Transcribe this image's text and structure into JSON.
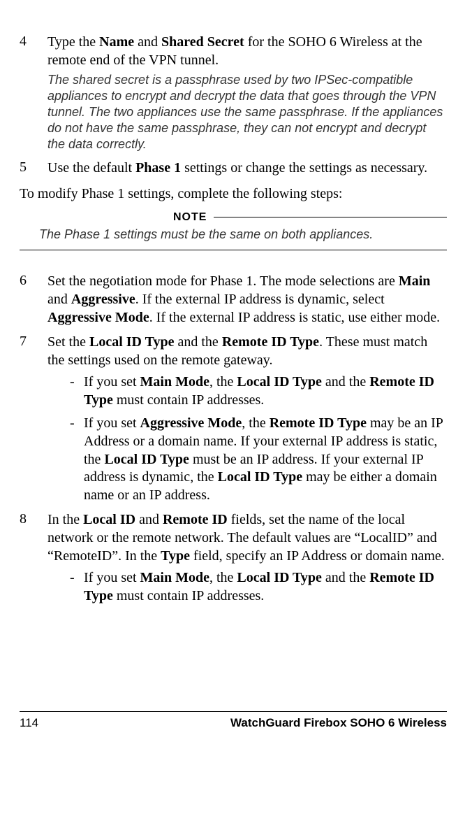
{
  "steps": {
    "s4": {
      "num": "4",
      "text_parts": [
        "Type the ",
        "Name",
        " and ",
        "Shared Secret",
        " for the SOHO 6 Wireless at the remote end of the VPN tunnel."
      ],
      "subnote": "The shared secret is a passphrase used by two IPSec-compatible appliances to encrypt and decrypt the data that goes through the VPN tunnel. The two appliances use the same passphrase. If the appliances do not have the same passphrase, they can not encrypt and decrypt the data correctly."
    },
    "s5": {
      "num": "5",
      "text_parts": [
        "Use the default ",
        "Phase 1",
        " settings or change the settings as necessary."
      ]
    },
    "intro_phase1": "To modify Phase 1 settings, complete the following steps:",
    "note": {
      "label": "NOTE",
      "body": "The Phase 1 settings must be the same on both appliances."
    },
    "s6": {
      "num": "6",
      "text_parts": [
        "Set the negotiation mode for Phase 1. The mode selections are ",
        "Main",
        " and ",
        "Aggressive",
        ". If the external IP address is dynamic, select ",
        "Aggressive Mode",
        ". If the external IP address is static, use either mode."
      ]
    },
    "s7": {
      "num": "7",
      "text_parts": [
        "Set the ",
        "Local ID Type",
        " and the ",
        "Remote ID Type",
        ". These must match the settings used on the remote gateway."
      ],
      "bullets": [
        {
          "parts": [
            "If you set ",
            "Main Mode",
            ", the ",
            "Local ID Type",
            " and the ",
            "Remote ID Type",
            " must contain IP addresses."
          ]
        },
        {
          "parts": [
            "If you set ",
            "Aggressive Mode",
            ", the ",
            "Remote ID Type",
            " may be an IP Address or a domain name. If your external IP address is static, the ",
            "Local ID Type",
            " must be an IP address. If your external IP address is dynamic, the ",
            "Local ID Type",
            " may be either a domain name or an IP address."
          ]
        }
      ]
    },
    "s8": {
      "num": "8",
      "text_parts": [
        "In the ",
        "Local ID",
        " and ",
        "Remote ID",
        " fields, set the name of the local network or the remote network. The default values are “LocalID” and “RemoteID”. In the ",
        "Type",
        " field, specify an IP Address or domain name."
      ],
      "bullets": [
        {
          "parts": [
            "If you set ",
            "Main Mode",
            ", the ",
            "Local ID Type",
            " and the ",
            "Remote ID Type",
            " must contain IP addresses."
          ]
        }
      ]
    }
  },
  "footer": {
    "page_number": "114",
    "title": "WatchGuard Firebox SOHO 6 Wireless"
  }
}
